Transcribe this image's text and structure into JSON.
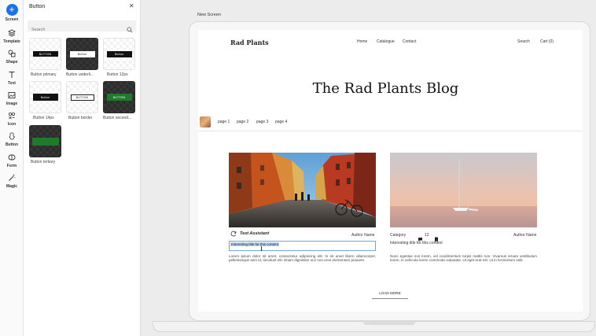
{
  "rail": [
    {
      "label": "Screen",
      "icon": "plus-icon"
    },
    {
      "label": "Template",
      "icon": "layers-icon"
    },
    {
      "label": "Shape",
      "icon": "shape-icon"
    },
    {
      "label": "Text",
      "icon": "text-icon"
    },
    {
      "label": "Image",
      "icon": "image-icon"
    },
    {
      "label": "Icon",
      "icon": "icon-grid-icon"
    },
    {
      "label": "Button",
      "icon": "button-icon"
    },
    {
      "label": "Form",
      "icon": "form-icon"
    },
    {
      "label": "Magic",
      "icon": "magic-wand-icon"
    }
  ],
  "panel": {
    "title": "Button",
    "search_placeholder": "Search",
    "tiles": [
      {
        "label": "Button primary",
        "mini": "BUTTON"
      },
      {
        "label": "Button underli...",
        "mini": "Button"
      },
      {
        "label": "Button 12px",
        "mini": "Button"
      },
      {
        "label": "Button 14px",
        "mini": "Button"
      },
      {
        "label": "Button border",
        "mini": "BUTTON"
      },
      {
        "label": "Button second...",
        "mini": "BUTTON"
      },
      {
        "label": "Button tertiary",
        "mini": ""
      }
    ]
  },
  "canvas": {
    "screen_label": "New Screen"
  },
  "site": {
    "brand": "Rad Plants",
    "nav": [
      "Home",
      "Catalogue",
      "Contact"
    ],
    "search": "Search",
    "cart": "Cart (0)",
    "blog_title": "The Rad Plants Blog",
    "pages": [
      "page 1",
      "page 2",
      "page 3",
      "page 4"
    ],
    "card1": {
      "assistant": "Text Assistant",
      "author": "Author Name",
      "title_value": "Interesting title for this content",
      "body": "Lorem ipsum dolor sit amet, consectetur adipiscing elit. In sit amet libero ullamcorper, pellentesque sem id, tincidunt elit. Etiam dignissim orci non eros elementum posuere."
    },
    "card2": {
      "category": "Category",
      "comments": "12",
      "author": "Author Name",
      "title": "Interesting title for this content",
      "body": "Nunc egestas non lorem, vel condimentum turpis mattis non. Vivamus ornare vestibulum lorem, in vehicula lorem commodo vulputate. Ut eget erat est. Ut in fermentum velit."
    },
    "load_more": "LOAD MORE"
  },
  "colors": {
    "accent": "#1a73e8",
    "button_green": "#1f7a2a",
    "selection": "#b9d3f3"
  }
}
